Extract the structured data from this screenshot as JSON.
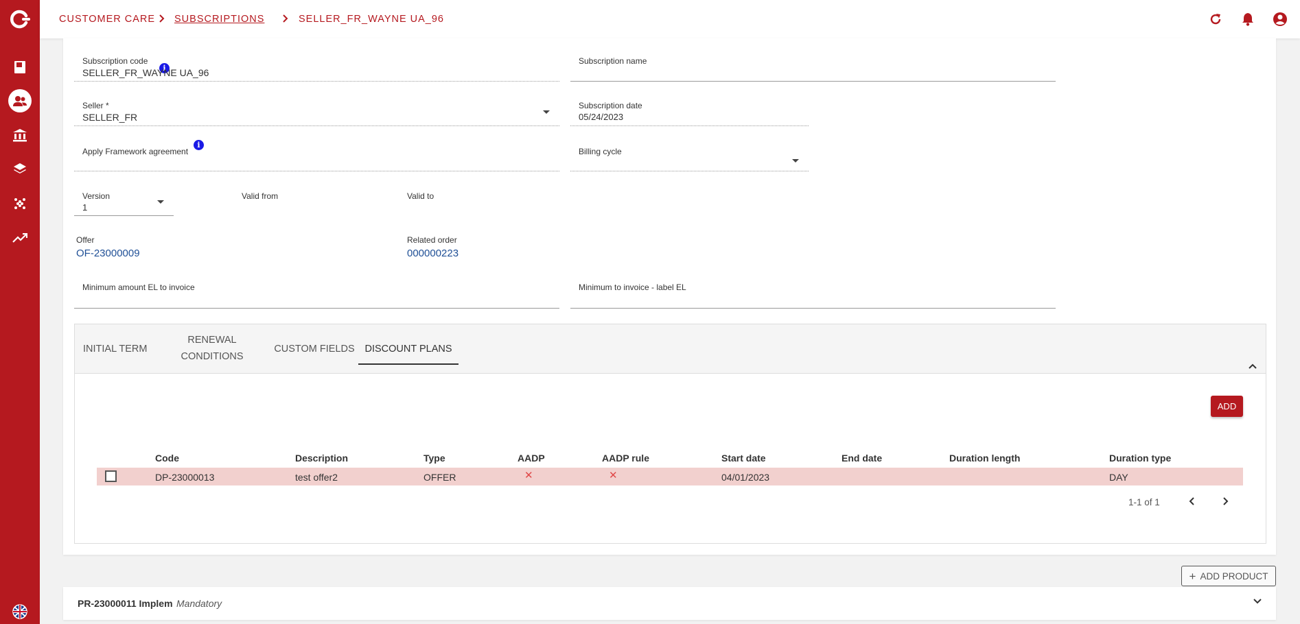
{
  "breadcrumb": {
    "items": [
      "CUSTOMER CARE",
      "SUBSCRIPTIONS",
      "SELLER_FR_WAYNE UA_96"
    ]
  },
  "header_icons": [
    "refresh-icon",
    "bell-icon",
    "account-icon"
  ],
  "sidebar_icons": [
    "logo-icon",
    "book-icon",
    "customers-icon",
    "bank-icon",
    "layers-icon",
    "dots-grid-icon",
    "trend-icon",
    "language-flag-icon"
  ],
  "form": {
    "subscription_code": {
      "label": "Subscription code",
      "value": "SELLER_FR_WAYNE UA_96"
    },
    "subscription_name": {
      "label": "Subscription name",
      "value": ""
    },
    "seller": {
      "label": "Seller *",
      "value": "SELLER_FR"
    },
    "subscription_date": {
      "label": "Subscription date",
      "value": "05/24/2023"
    },
    "framework_agreement": {
      "label": "Apply Framework agreement",
      "value": ""
    },
    "billing_cycle": {
      "label": "Billing cycle",
      "value": ""
    },
    "version": {
      "label": "Version",
      "value": "1"
    },
    "valid_from": {
      "label": "Valid from"
    },
    "valid_to": {
      "label": "Valid to"
    },
    "offer": {
      "label": "Offer",
      "value": "OF-23000009"
    },
    "related_order": {
      "label": "Related order",
      "value": "000000223"
    },
    "min_amount": {
      "label": "Minimum amount EL to invoice",
      "value": ""
    },
    "min_label": {
      "label": "Minimum to invoice - label EL",
      "value": ""
    }
  },
  "tabs": [
    {
      "label": "INITIAL TERM"
    },
    {
      "label_line1": "RENEWAL",
      "label_line2": "CONDITIONS"
    },
    {
      "label": "CUSTOM FIELDS"
    },
    {
      "label": "DISCOUNT PLANS",
      "active": true
    }
  ],
  "discount_plans": {
    "add_label": "ADD",
    "columns": [
      "Code",
      "Description",
      "Type",
      "AADP",
      "AADP rule",
      "Start date",
      "End date",
      "Duration length",
      "Duration type"
    ],
    "rows": [
      {
        "code": "DP-23000013",
        "description": "test offer2",
        "type": "OFFER",
        "aadp": "✕",
        "aadp_rule": "✕",
        "start_date": "04/01/2023",
        "end_date": "",
        "duration_length": "",
        "duration_type": "DAY"
      }
    ],
    "pagination": "1-1 of 1"
  },
  "add_product_label": "ADD PRODUCT",
  "product": {
    "code": "PR-23000011 Implem",
    "tag": "Mandatory"
  },
  "colors": {
    "brand": "#b5191f",
    "row_highlight": "#f2d0ce",
    "link": "#1f4f96",
    "info": "#1a1ae6"
  }
}
